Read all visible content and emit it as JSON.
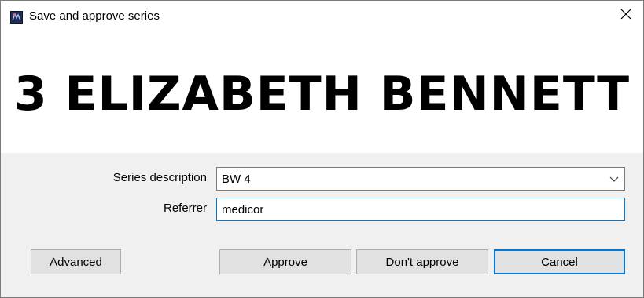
{
  "window": {
    "title": "Save and approve series",
    "app_icon": "app-logo-icon",
    "close_icon": "close-icon"
  },
  "banner": {
    "patient_name": "3 ELIZABETH BENNETT"
  },
  "form": {
    "series_description_label": "Series description",
    "series_description_value": "BW 4",
    "referrer_label": "Referrer",
    "referrer_value": "medicor"
  },
  "buttons": {
    "advanced": "Advanced",
    "approve": "Approve",
    "dont_approve": "Don't approve",
    "cancel": "Cancel"
  },
  "colors": {
    "focus_accent": "#0078d7",
    "form_background": "#f0f0f0",
    "button_face": "#e1e1e1"
  }
}
